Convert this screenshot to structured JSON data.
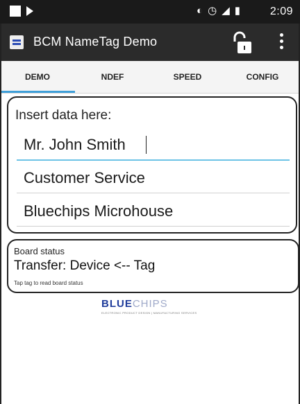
{
  "status_bar": {
    "time": "2:09",
    "icons": [
      "timer-icon",
      "alarm-icon",
      "signal-icon",
      "battery-icon"
    ]
  },
  "app_bar": {
    "title": "BCM NameTag Demo"
  },
  "tabs": [
    {
      "label": "DEMO",
      "active": true
    },
    {
      "label": "NDEF",
      "active": false
    },
    {
      "label": "SPEED",
      "active": false
    },
    {
      "label": "CONFIG",
      "active": false
    }
  ],
  "insert": {
    "label": "Insert data here:",
    "fields": [
      {
        "value": "Mr. John Smith"
      },
      {
        "value": "Customer Service"
      },
      {
        "value": "Bluechips Microhouse"
      }
    ]
  },
  "board": {
    "title": "Board status",
    "transfer": "Transfer: Device <-- Tag",
    "hint": "Tap tag to read board status"
  },
  "brand": {
    "part1": "BLUE",
    "part2": "CHIPS",
    "tagline": "ELECTRONIC PRODUCT DESIGN | MANUFACTURING SERVICES"
  },
  "colors": {
    "accent": "#3f9fd8",
    "brand_blue": "#1f3c9b",
    "appbar": "#2b2b2b"
  }
}
